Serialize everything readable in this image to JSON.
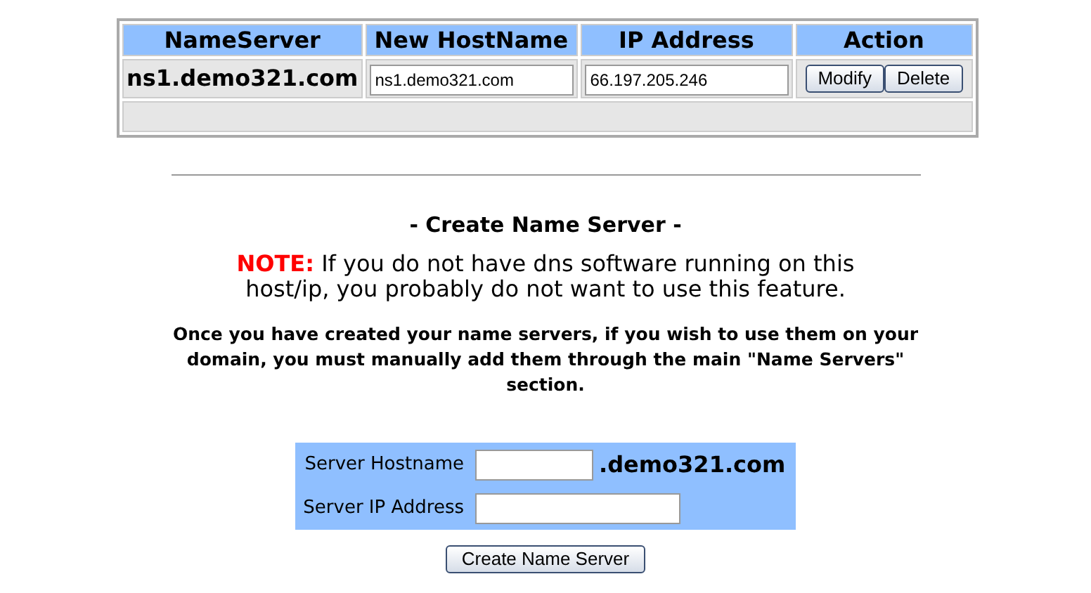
{
  "nameservers_table": {
    "columns": [
      "NameServer",
      "New HostName",
      "IP Address",
      "Action"
    ],
    "rows": [
      {
        "nameserver": "ns1.demo321.com",
        "new_hostname": "ns1.demo321.com",
        "ip_address": "66.197.205.246",
        "actions": [
          "Modify",
          "Delete"
        ]
      }
    ]
  },
  "create_section": {
    "title": "- Create Name Server -",
    "note_label": "NOTE:",
    "note_text": "If you do not have dns software running on this host/ip, you probably do not want to use this feature.",
    "info": "Once you have created your name servers, if you wish to use them on your domain, you must manually add them through the main \"Name Servers\" section.",
    "form": {
      "fields": [
        {
          "label": "Server Hostname",
          "suffix": ".demo321.com"
        },
        {
          "label": "Server IP Address"
        }
      ],
      "submit": "Create Name Server"
    }
  }
}
